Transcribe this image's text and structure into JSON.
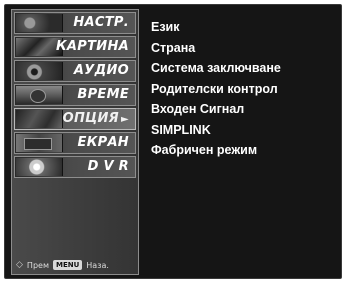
{
  "menu": {
    "items": [
      {
        "label": "НАСТР.",
        "thumb": "t1",
        "selected": false
      },
      {
        "label": "КАРТИНА",
        "thumb": "t2",
        "selected": false
      },
      {
        "label": "АУДИО",
        "thumb": "t3",
        "selected": false
      },
      {
        "label": "ВРЕМЕ",
        "thumb": "t4",
        "selected": false
      },
      {
        "label": "ОПЦИЯ",
        "thumb": "t5",
        "selected": true,
        "arrow": "►"
      },
      {
        "label": "ЕКРАН",
        "thumb": "t6",
        "selected": false
      },
      {
        "label": "D V R",
        "thumb": "t7",
        "selected": false
      }
    ]
  },
  "hint": {
    "move_icon": "◇",
    "move_label": "Прем",
    "menu_key": "MENU",
    "back_label": "Наза."
  },
  "options": [
    "Език",
    "Страна",
    "Система заключване",
    "Родителски контрол",
    "Входен Сигнал",
    "SIMPLINK",
    "Фабричен режим"
  ]
}
